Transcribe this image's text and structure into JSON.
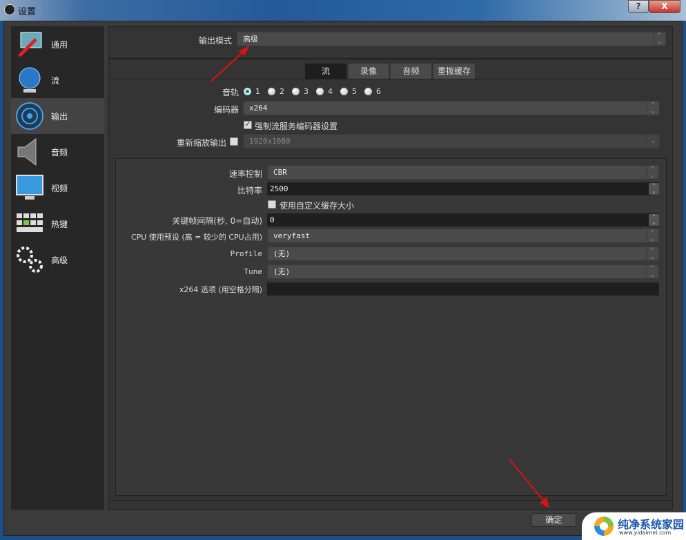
{
  "window": {
    "title": "设置",
    "help": "?",
    "close": "X"
  },
  "sidebar": {
    "items": [
      {
        "label": "通用",
        "icon": "general-icon"
      },
      {
        "label": "流",
        "icon": "globe-icon"
      },
      {
        "label": "输出",
        "icon": "broadcast-icon",
        "selected": true
      },
      {
        "label": "音频",
        "icon": "speaker-icon"
      },
      {
        "label": "视频",
        "icon": "monitor-icon"
      },
      {
        "label": "热键",
        "icon": "keyboard-icon"
      },
      {
        "label": "高级",
        "icon": "gears-icon"
      }
    ]
  },
  "output_mode": {
    "label": "输出模式",
    "value": "高级"
  },
  "tabs": [
    {
      "label": "流",
      "active": true
    },
    {
      "label": "录像"
    },
    {
      "label": "音频"
    },
    {
      "label": "重拨缓存"
    }
  ],
  "stream": {
    "audio_track": {
      "label": "音轨",
      "options": [
        "1",
        "2",
        "3",
        "4",
        "5",
        "6"
      ],
      "selected": "1"
    },
    "encoder": {
      "label": "编码器",
      "value": "x264"
    },
    "enforce": {
      "label": "强制流服务编码器设置",
      "checked": true
    },
    "rescale": {
      "label": "重新缩放输出",
      "checked": false,
      "value": "1920x1080"
    },
    "rate_control": {
      "label": "速率控制",
      "value": "CBR"
    },
    "bitrate": {
      "label": "比特率",
      "value": "2500"
    },
    "custom_buffer": {
      "label": "使用自定义缓存大小",
      "checked": false
    },
    "keyframe": {
      "label": "关键帧间隔(秒, 0=自动)",
      "value": "0"
    },
    "cpu_preset": {
      "label": "CPU 使用预设 (高 = 较少的 CPU占用)",
      "value": "veryfast"
    },
    "profile": {
      "label": "Profile",
      "value": "(无)"
    },
    "tune": {
      "label": "Tune",
      "value": "(无)"
    },
    "x264_opts": {
      "label": "x264 选项 (用空格分隔)",
      "value": ""
    }
  },
  "footer": {
    "ok": "确定"
  },
  "watermark": {
    "name": "纯净系统家园",
    "url": "www.yidaimei.com"
  },
  "colors": {
    "accent_arrow": "#e01010",
    "selected_tab": "#1e1e1e",
    "panel": "#343434"
  }
}
